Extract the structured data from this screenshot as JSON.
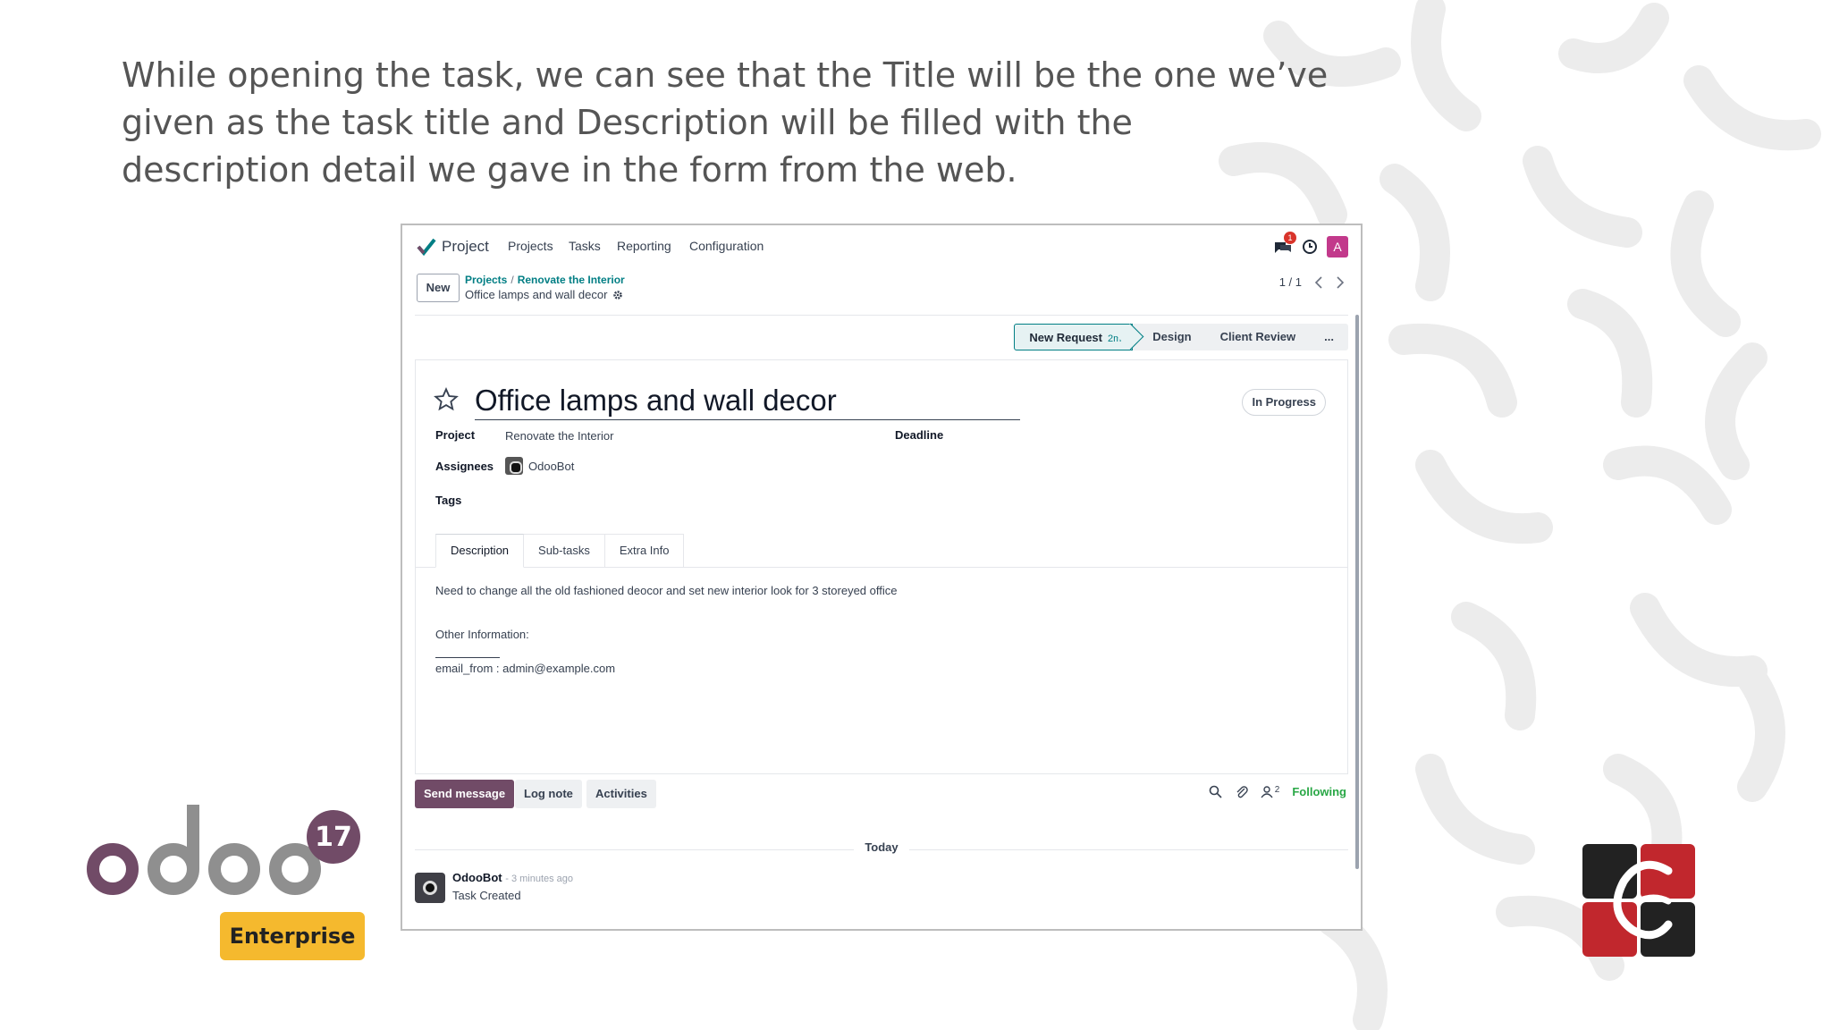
{
  "caption": {
    "line1": "While opening the task, we can see that the Title will be the one we’ve",
    "line2": "given as the task title and Description will be filled with the",
    "line3": "description detail we gave in the form from the web."
  },
  "navbar": {
    "app_name": "Project",
    "menu": [
      "Projects",
      "Tasks",
      "Reporting",
      "Configuration"
    ],
    "chat_badge": "1",
    "avatar_letter": "A"
  },
  "control_panel": {
    "new_label": "New",
    "breadcrumb_root": "Projects",
    "breadcrumb_parent": "Renovate the Interior",
    "breadcrumb_current": "Office lamps and wall decor",
    "pager": "1 / 1"
  },
  "stages": {
    "active": "New Request",
    "active_time": "2m",
    "others": [
      "Design",
      "Client Review",
      "..."
    ]
  },
  "task": {
    "title": "Office lamps and wall decor",
    "status": "In Progress",
    "project_label": "Project",
    "project_value": "Renovate the Interior",
    "deadline_label": "Deadline",
    "assignees_label": "Assignees",
    "assignee": "OdooBot",
    "tags_label": "Tags"
  },
  "tabs": [
    "Description",
    "Sub-tasks",
    "Extra Info"
  ],
  "description": {
    "line1": "Need to change all the old fashioned deocor and set new interior look for 3 storeyed office",
    "line2": "Other Information:",
    "line3": "email_from : admin@example.com"
  },
  "chatter": {
    "send_message": "Send message",
    "log_note": "Log note",
    "activities": "Activities",
    "followers_count": "2",
    "following": "Following",
    "date_separator": "Today",
    "author": "OdooBot",
    "ago": "- 3 minutes ago",
    "body": "Task Created"
  },
  "branding": {
    "odoo_version": "17",
    "edition": "Enterprise",
    "colors": {
      "odoo_purple": "#714b67",
      "odoo_grey": "#8f8f8f",
      "enterprise_yellow": "#f5b92e",
      "cybro_red": "#c1272d"
    }
  }
}
